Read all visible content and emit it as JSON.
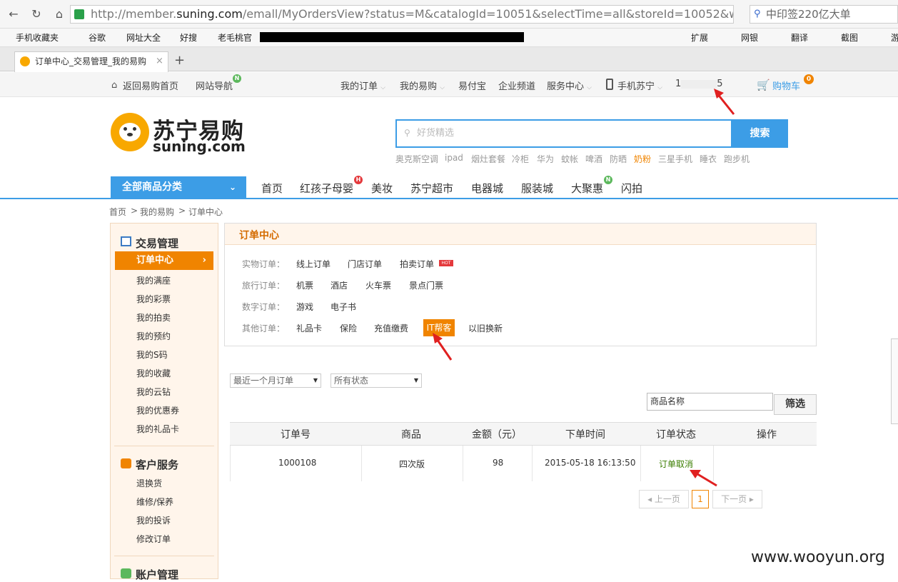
{
  "browser": {
    "url_prefix": "http://member.",
    "url_domain": "suning.com",
    "url_rest": "/emall/MyOrdersView?status=M&catalogId=10051&selectTime=all&storeId=10052&wc_",
    "search_text": "中印签220亿大单",
    "bookmarks": [
      "手机收藏夹",
      "谷歌",
      "网址大全",
      "好搜",
      "老毛桃官"
    ],
    "bookmark_right": [
      "扩展",
      "网银",
      "翻译",
      "截图",
      "游"
    ],
    "tab_title": "订单中心_交易管理_我的易购",
    "new_tab": "+"
  },
  "topbar": {
    "home": "返回易购首页",
    "sitenav": "网站导航",
    "my_orders": "我的订单",
    "my_yigou": "我的易购",
    "yifubao": "易付宝",
    "enterprise": "企业频道",
    "service": "服务中心",
    "mobile": "手机苏宁",
    "user_prefix": "1",
    "user_suffix": "5",
    "cart": "购物车",
    "cart_count": "0",
    "nav_badge": "N"
  },
  "header": {
    "logo_cn": "苏宁易购",
    "logo_en": "suning.com",
    "search_placeholder": "好货精选",
    "search_button": "搜索",
    "hot_words": [
      "奥克斯空调",
      "ipad",
      "烟灶套餐",
      "冷柜",
      "华为",
      "蚊帐",
      "啤酒",
      "防晒",
      "奶粉",
      "三星手机",
      "睡衣",
      "跑步机"
    ]
  },
  "mainnav": {
    "all_categories": "全部商品分类",
    "items": [
      "首页",
      "红孩子母婴",
      "美妆",
      "苏宁超市",
      "电器城",
      "服装城",
      "大聚惠",
      "闪拍"
    ],
    "badge_h": "H",
    "badge_n": "N"
  },
  "breadcrumb": [
    "首页",
    "我的易购",
    "订单中心"
  ],
  "sidebar": {
    "section1": "交易管理",
    "active": "订单中心",
    "items1": [
      "我的满座",
      "我的彩票",
      "我的拍卖",
      "我的预约",
      "我的S码",
      "我的收藏",
      "我的云钻",
      "我的优惠券",
      "我的礼品卡"
    ],
    "section2": "客户服务",
    "items2": [
      "退换货",
      "维修/保养",
      "我的投诉",
      "修改订单"
    ],
    "section3": "账户管理"
  },
  "order_center": {
    "title": "订单中心",
    "rows": [
      {
        "label": "实物订单：",
        "links": [
          "线上订单",
          "门店订单",
          "拍卖订单"
        ]
      },
      {
        "label": "旅行订单：",
        "links": [
          "机票",
          "酒店",
          "火车票",
          "景点门票"
        ]
      },
      {
        "label": "数字订单：",
        "links": [
          "游戏",
          "电子书"
        ]
      },
      {
        "label": "其他订单：",
        "links": [
          "礼品卡",
          "保险",
          "充值缴费",
          "IT帮客",
          "以旧换新"
        ]
      }
    ],
    "hot_tag": "HOT"
  },
  "filters": {
    "time": "最近一个月订单",
    "status": "所有状态",
    "keyword": "商品名称",
    "button": "筛选"
  },
  "table": {
    "headers": [
      "订单号",
      "商品",
      "金额（元）",
      "下单时间",
      "订单状态",
      "操作"
    ],
    "rows": [
      {
        "order_no": "1000108",
        "product": "四次版",
        "amount": "98",
        "time": "2015-05-18 16:13:50",
        "status": "订单取消",
        "action": ""
      }
    ]
  },
  "pager": {
    "prev": "上一页",
    "current": "1",
    "next": "下一页"
  },
  "watermark": "www.wooyun.org",
  "colors": {
    "accent": "#3c9de6",
    "orange": "#f08400",
    "status_green": "#3a7d00",
    "arrow_red": "#e02020"
  }
}
